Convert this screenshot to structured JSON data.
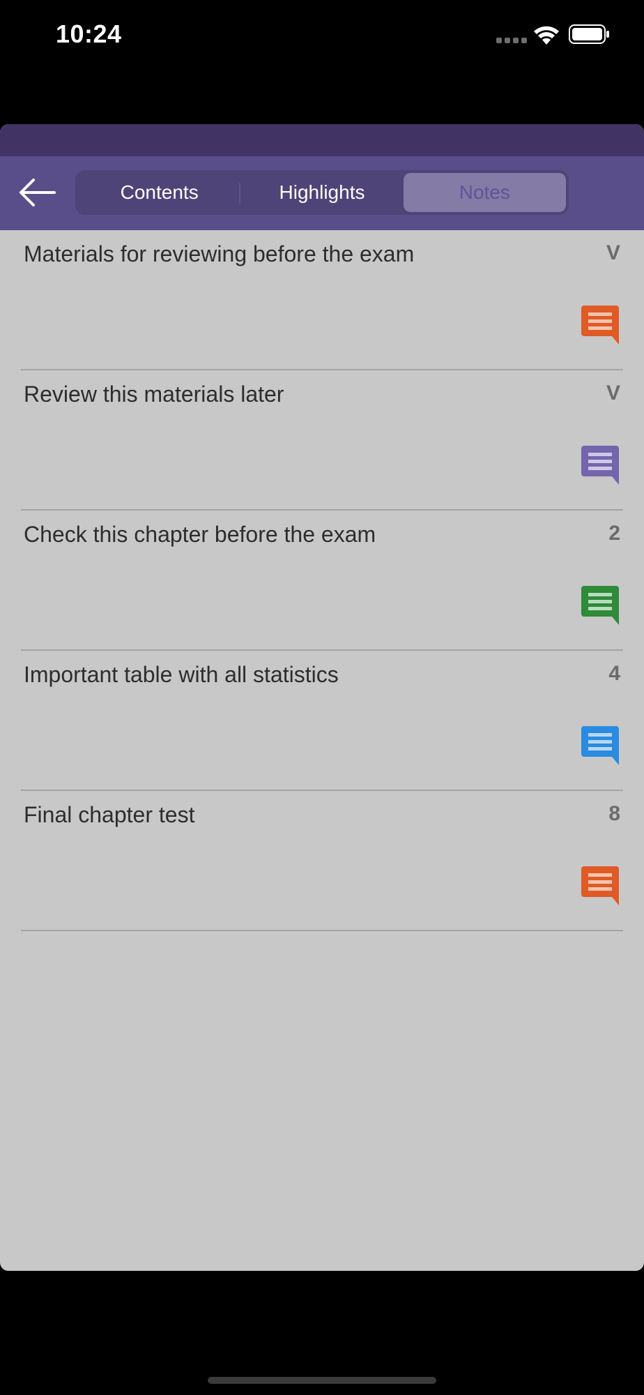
{
  "status": {
    "time": "10:24"
  },
  "nav": {
    "back_icon": "arrow-left-icon",
    "tabs": [
      {
        "label": "Contents",
        "active": false
      },
      {
        "label": "Highlights",
        "active": false
      },
      {
        "label": "Notes",
        "active": true
      }
    ]
  },
  "notes": [
    {
      "title": "Materials for reviewing before the exam",
      "page": "V",
      "icon": "note-bubble-icon",
      "color": "#e05a26"
    },
    {
      "title": "Review this materials later",
      "page": "V",
      "icon": "note-bubble-icon",
      "color": "#7465ad"
    },
    {
      "title": "Check this chapter before the exam",
      "page": "2",
      "icon": "note-bubble-icon",
      "color": "#2f8a3a"
    },
    {
      "title": "Important table with all statistics",
      "page": "4",
      "icon": "note-bubble-icon",
      "color": "#2a8be0"
    },
    {
      "title": "Final chapter test",
      "page": "8",
      "icon": "note-bubble-icon",
      "color": "#e05a26"
    }
  ],
  "colors": {
    "nav_background": "#594e8a",
    "header_band": "#413464",
    "sheet_background": "#c8c8c8",
    "active_tab_text": "#5f5499"
  }
}
